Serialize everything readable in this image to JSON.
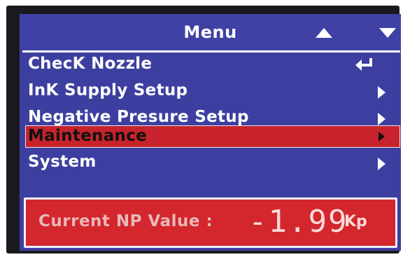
{
  "menu": {
    "title": "Menu",
    "up_icon": "triangle-up-icon",
    "down_icon": "triangle-down-icon",
    "items": [
      {
        "label": "ChecK Nozzle",
        "icon": "enter-return-icon"
      },
      {
        "label": "InK Supply Setup",
        "icon": "chevron-right-icon"
      },
      {
        "label": "Negative Presure Setup",
        "icon": "chevron-right-icon"
      },
      {
        "label": "Maintenance",
        "icon": "chevron-right-icon",
        "selected": true
      },
      {
        "label": "System",
        "icon": "chevron-right-icon"
      }
    ]
  },
  "status": {
    "label": "Current NP Value :",
    "value": "-1.99",
    "unit": "Kp"
  },
  "colors": {
    "screen_bg": "#3d3fa0",
    "selected_row": "#c8232c",
    "status_panel": "#d3262d",
    "text": "#ffffff"
  }
}
